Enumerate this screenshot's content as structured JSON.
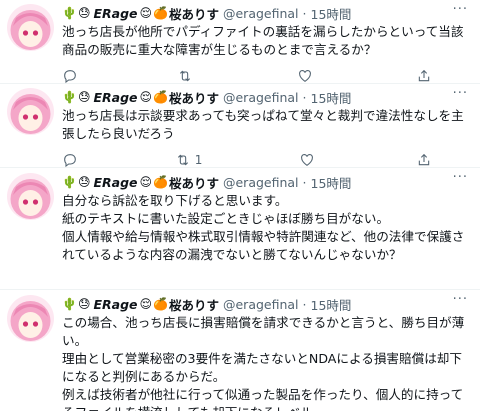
{
  "user": {
    "display_name": "ERage",
    "name_suffix": "桜ありす",
    "handle": "@eragefinal",
    "time": "15時間",
    "separator": "·",
    "more": "···"
  },
  "tweets": [
    {
      "text": "池っち店長が他所でパディファイトの裏話を漏らしたからといって当該商品の販売に重大な障害が生じるものとまで言えるか？",
      "retweets": "",
      "likes": ""
    },
    {
      "text": "池っち店長は示談要求あっても突っぱねて堂々と裁判で違法性なしを主張したら良いだろう",
      "retweets": "1",
      "likes": ""
    },
    {
      "text": "自分なら訴訟を取り下げると思います。\n紙のテキストに書いた設定ごときじゃほぼ勝ち目がない。\n個人情報や給与情報や株式取引情報や特許関連など、他の法律で保護されているような内容の漏洩でないと勝てないんじゃないか？",
      "retweets": "",
      "likes": ""
    },
    {
      "text": "この場合、池っち店長に損害賠償を請求できるかと言うと、勝ち目が薄い。\n理由として営業秘密の3要件を満たさないとNDAによる損害賠償は却下になると判例にあるからだ。\n例えば技術者が他社に行って似通った製品を作ったり、個人的に持ってるファイルを横流ししても却下になるレベル。",
      "retweets": "",
      "likes": ""
    }
  ],
  "icons": [
    "reply-icon",
    "retweet-icon",
    "like-icon",
    "share-icon",
    "more-icon"
  ],
  "colors": {
    "muted": "#536471",
    "text": "#0f1419",
    "divider": "#eff3f4",
    "avatar_hair": "#f4a6c8"
  }
}
